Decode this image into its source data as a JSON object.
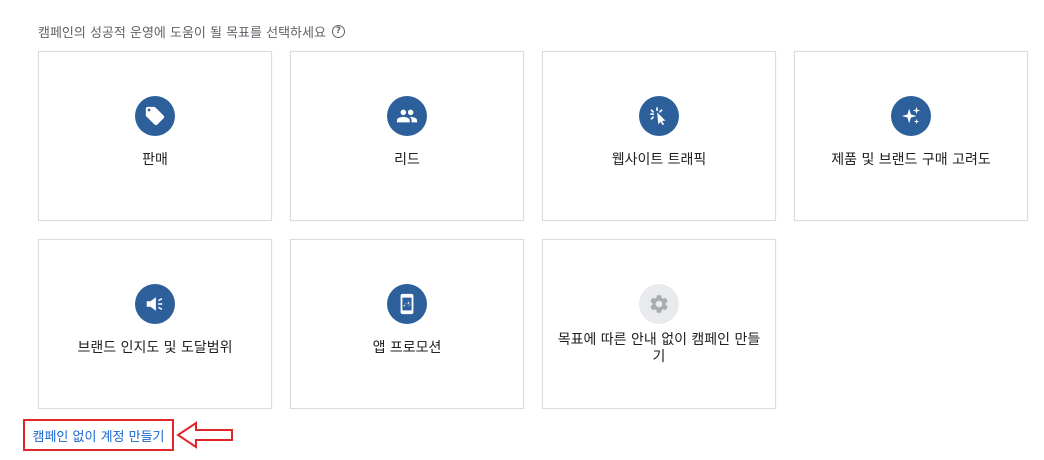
{
  "prompt": {
    "text": "캠페인의 성공적 운영에 도움이 될 목표를 선택하세요",
    "help_glyph": "?"
  },
  "goals": [
    {
      "label": "판매",
      "icon": "sales-tag-icon"
    },
    {
      "label": "리드",
      "icon": "leads-people-icon"
    },
    {
      "label": "웹사이트 트래픽",
      "icon": "website-traffic-cursor-icon"
    },
    {
      "label": "제품 및 브랜드 구매 고려도",
      "icon": "sparkle-icon"
    },
    {
      "label": "브랜드 인지도 및 도달범위",
      "icon": "megaphone-icon"
    },
    {
      "label": "앱 프로모션",
      "icon": "mobile-app-icon"
    },
    {
      "label": "목표에 따른 안내 없이 캠페인 만들기",
      "icon": "gear-icon"
    }
  ],
  "footer": {
    "link_label": "캠페인 없이 계정 만들기"
  },
  "colors": {
    "icon_bg": "#2d5f9a",
    "icon_bg_disabled": "#e8eaed",
    "link": "#1a66d2",
    "highlight": "#e0262b"
  }
}
